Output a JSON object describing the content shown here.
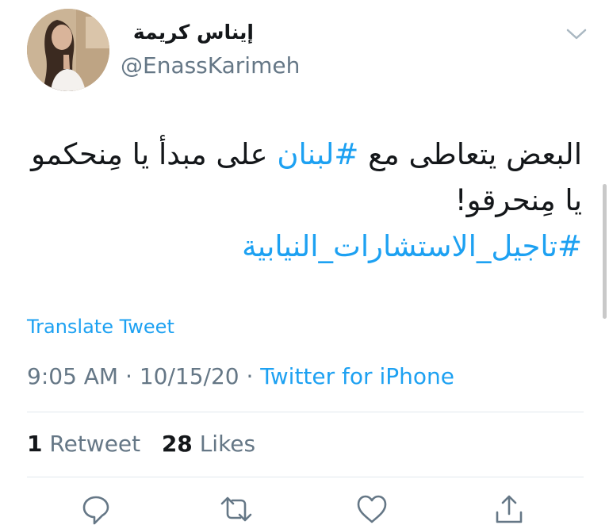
{
  "tweet": {
    "author": {
      "display_name": "إيناس كريمة",
      "handle": "@EnassKarimeh",
      "avatar_icon": "user-avatar-photo"
    },
    "menu_icon": "chevron-down-icon",
    "text_lines": [
      {
        "before": "البعض يتعاطى مع ",
        "hashtag": "#لبنان",
        "after": " على مبدأ يا مِنحكمو"
      },
      {
        "before": "يا مِنحرقو!",
        "hashtag": "",
        "after": ""
      },
      {
        "before": "",
        "hashtag": "#تاجيل_الاستشارات_النيابية",
        "after": ""
      }
    ],
    "translate_label": "Translate Tweet",
    "time": "9:05 AM",
    "date": "10/15/20",
    "separator": "·",
    "source": "Twitter for iPhone",
    "retweet_count": "1",
    "retweet_label": "Retweet",
    "like_count": "28",
    "like_label": "Likes",
    "actions": [
      "reply-icon",
      "retweet-icon",
      "like-icon",
      "share-icon"
    ]
  },
  "colors": {
    "accent": "#1da1f2",
    "text": "#14171a",
    "muted": "#657786",
    "divider": "#e1e8ed"
  }
}
